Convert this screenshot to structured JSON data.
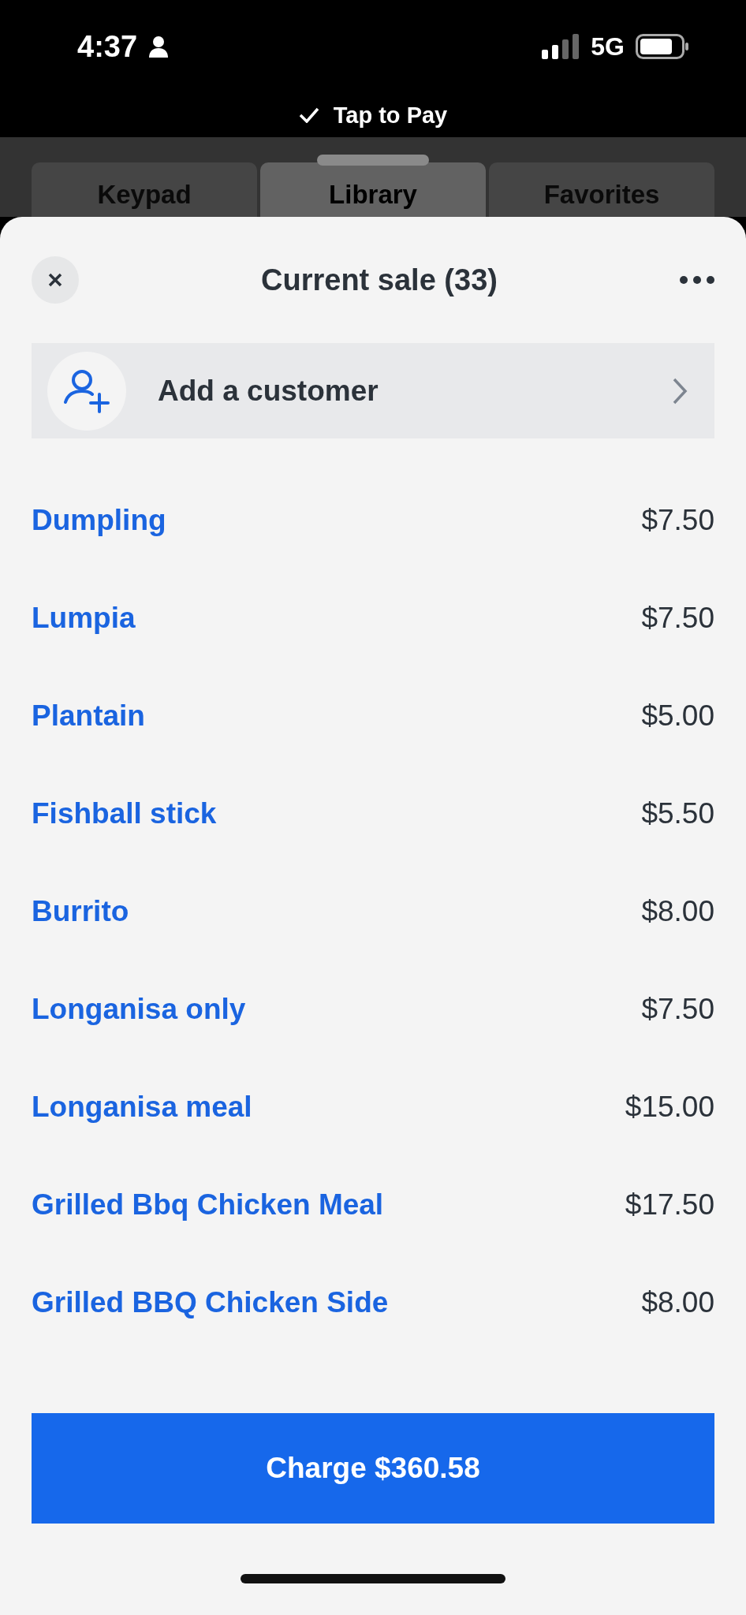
{
  "status_bar": {
    "time": "4:37",
    "network": "5G"
  },
  "banner": {
    "label": "Tap to Pay"
  },
  "tabs": [
    {
      "label": "Keypad",
      "selected": false
    },
    {
      "label": "Library",
      "selected": true
    },
    {
      "label": "Favorites",
      "selected": false
    }
  ],
  "sheet": {
    "title": "Current sale (33)",
    "customer": {
      "label": "Add a customer"
    },
    "items": [
      {
        "name": "Dumpling",
        "price": "$7.50"
      },
      {
        "name": "Lumpia",
        "price": "$7.50"
      },
      {
        "name": "Plantain",
        "price": "$5.00"
      },
      {
        "name": "Fishball stick",
        "price": "$5.50"
      },
      {
        "name": "Burrito",
        "price": "$8.00"
      },
      {
        "name": "Longanisa only",
        "price": "$7.50"
      },
      {
        "name": "Longanisa meal",
        "price": "$15.00"
      },
      {
        "name": "Grilled Bbq Chicken Meal",
        "price": "$17.50"
      },
      {
        "name": "Grilled BBQ Chicken Side",
        "price": "$8.00"
      }
    ],
    "charge_button": "Charge $360.58"
  }
}
